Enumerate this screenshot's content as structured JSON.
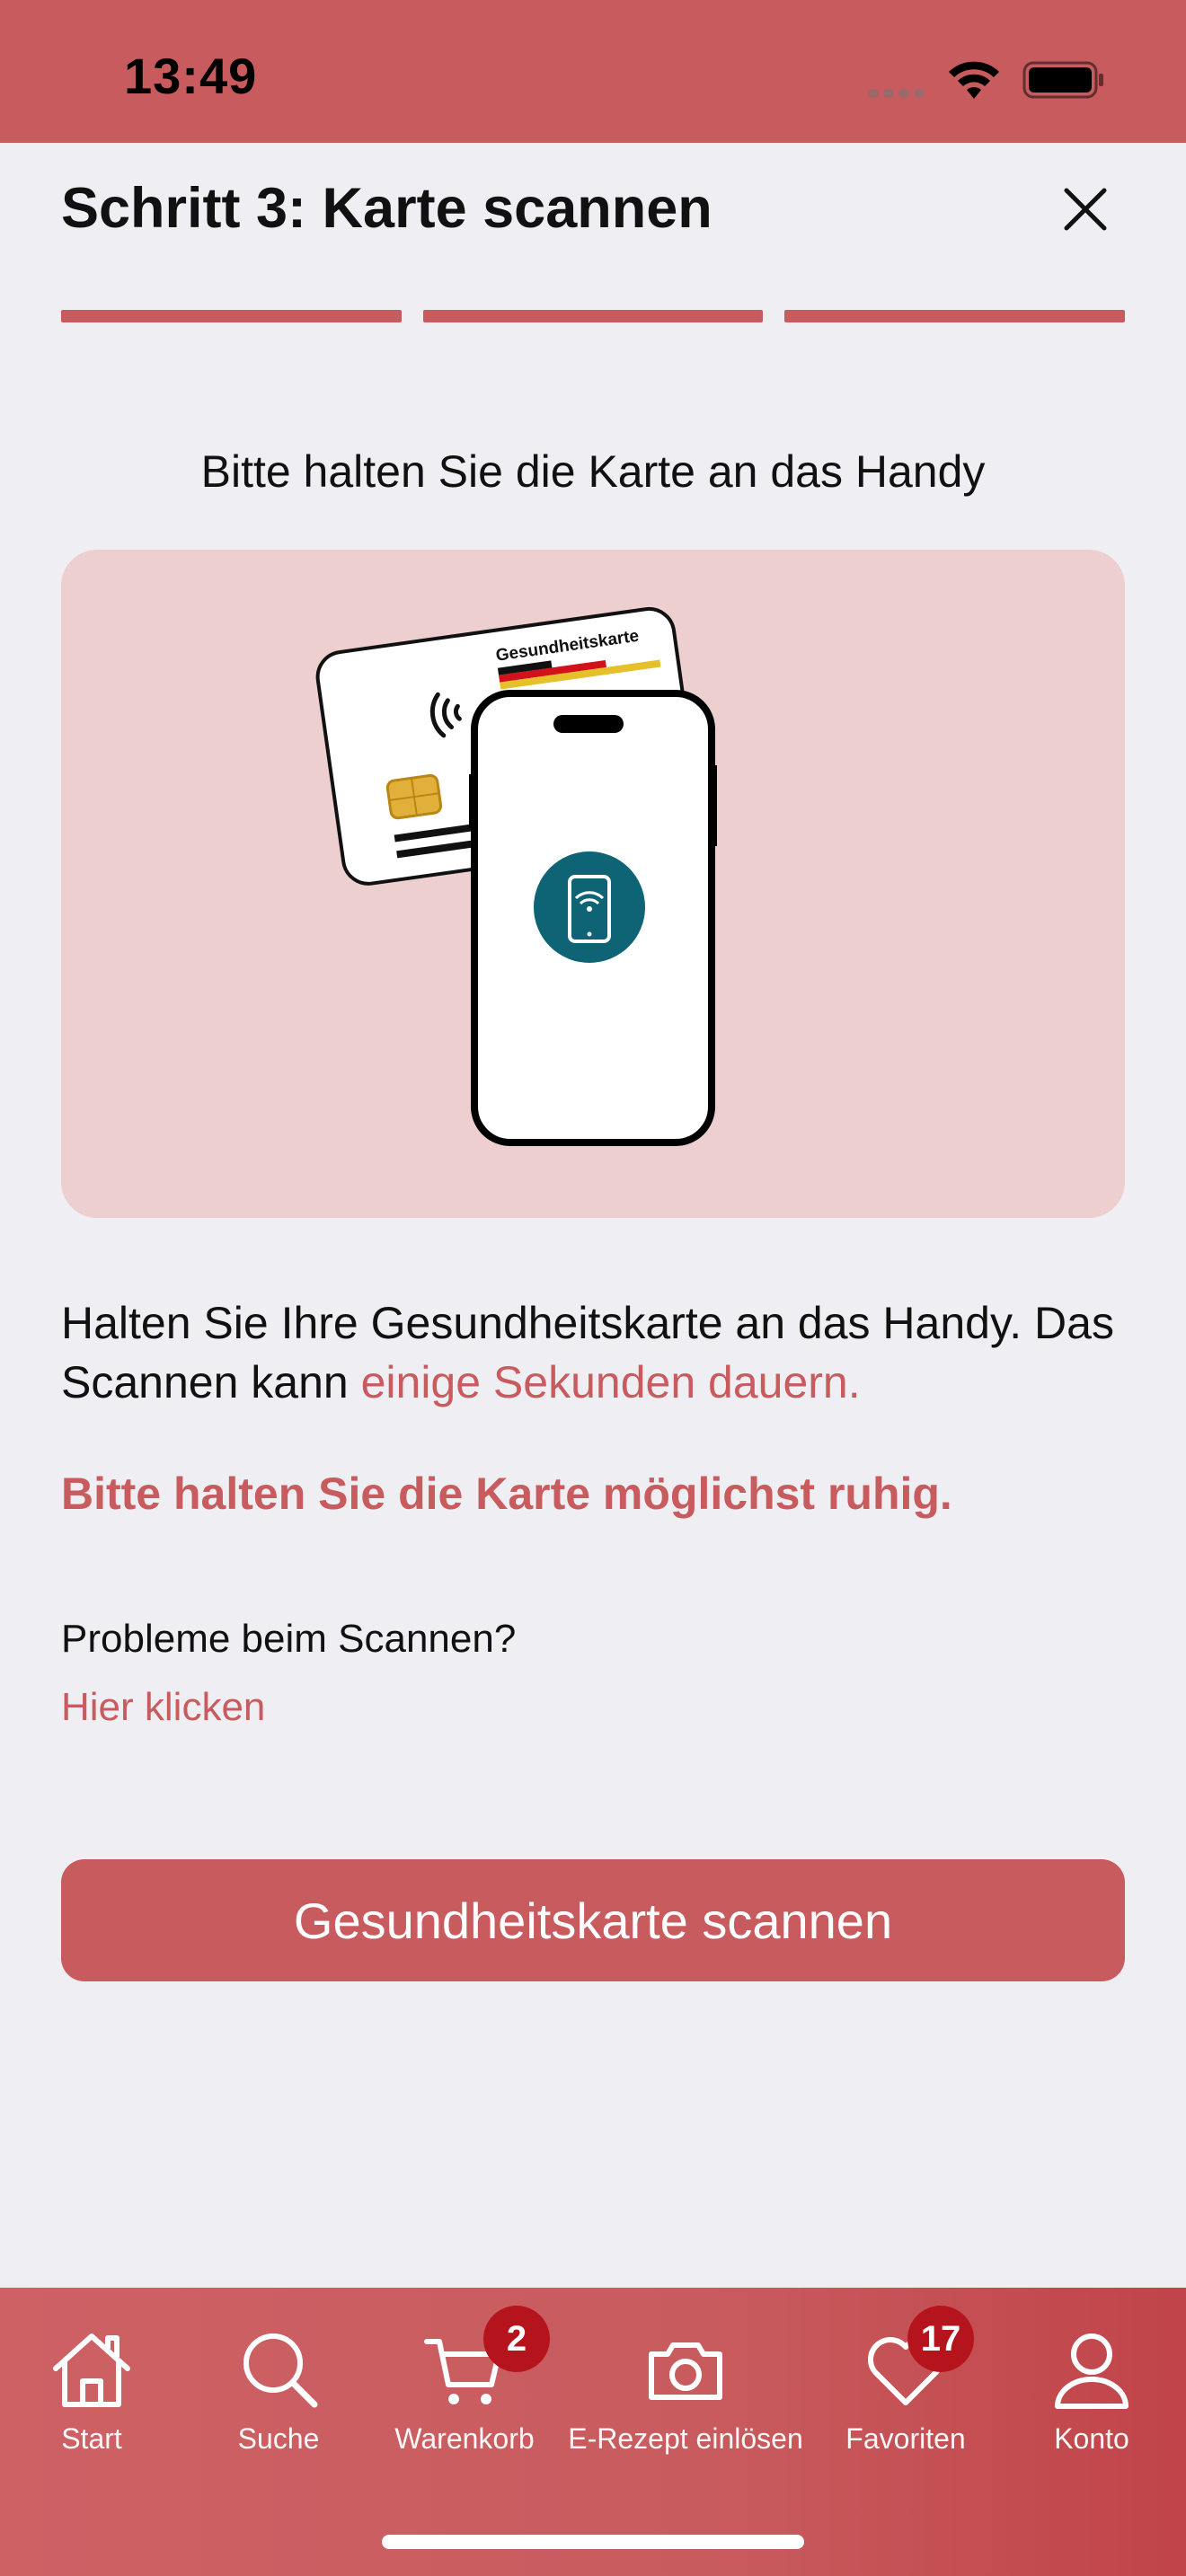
{
  "status_bar": {
    "time": "13:49"
  },
  "header": {
    "title": "Schritt 3: Karte scannen",
    "progress_steps_completed": 3,
    "progress_steps_total": 3
  },
  "main": {
    "instruction": "Bitte halten Sie die Karte an das Handy",
    "illustration": {
      "card_label": "Gesundheitskarte"
    },
    "description_part1": "Halten Sie Ihre Gesundheitskarte an das Handy. Das Scannen kann ",
    "description_highlight": "einige Sekunden dauern.",
    "warning": "Bitte halten Sie die Karte möglichst ruhig.",
    "problem_text": "Probleme beim Scannen?",
    "help_link": "Hier klicken",
    "scan_button": "Gesundheitskarte scannen"
  },
  "tabs": [
    {
      "label": "Start",
      "icon": "home-icon"
    },
    {
      "label": "Suche",
      "icon": "search-icon"
    },
    {
      "label": "Warenkorb",
      "icon": "cart-icon",
      "badge": "2"
    },
    {
      "label": "E-Rezept einlösen",
      "icon": "camera-icon"
    },
    {
      "label": "Favoriten",
      "icon": "heart-icon",
      "badge": "17"
    },
    {
      "label": "Konto",
      "icon": "user-icon"
    }
  ],
  "colors": {
    "accent": "#c85b5e",
    "background": "#efeff3",
    "badge": "#b5141c",
    "illustration_bg": "#edcfd0",
    "phone_icon_bg": "#0e6374"
  }
}
